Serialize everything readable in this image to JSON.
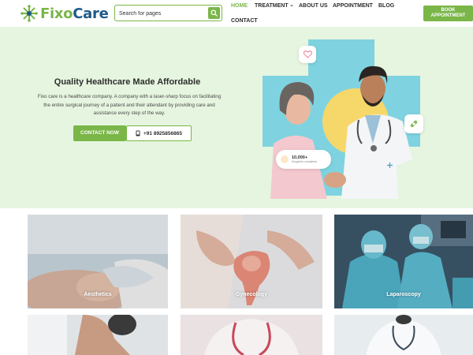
{
  "brand": {
    "name_part1": "Fixo",
    "name_part2": "Care"
  },
  "search": {
    "placeholder": "Search for pages"
  },
  "nav": {
    "items": [
      {
        "label": "HOME",
        "active": true
      },
      {
        "label": "TREATMENT",
        "has_dropdown": true
      },
      {
        "label": "ABOUT US"
      },
      {
        "label": "APPOINTMENT"
      },
      {
        "label": "BLOG"
      },
      {
        "label": "CONTACT"
      }
    ],
    "book_button": [
      "BOOK",
      "APPOINTMENT"
    ]
  },
  "hero": {
    "title": "Quality Healthcare Made Affordable",
    "description": "Fixo care is a healthcare company. A company with a laser-sharp focus on facilitating the entire surgical journey of a patient and their attendant by providing care and assistance every step of the way.",
    "contact_button": "CONTACT NOW",
    "phone": "+91 8925856865",
    "stat_number": "10,000+",
    "stat_label": "Surgeries completed"
  },
  "services": [
    {
      "label": "Aesthetics"
    },
    {
      "label": "Gynecology"
    },
    {
      "label": "Laparoscopy"
    },
    {
      "label": ""
    },
    {
      "label": ""
    },
    {
      "label": ""
    }
  ],
  "colors": {
    "brand_green": "#7ab648",
    "brand_blue": "#1d5a8a",
    "hero_bg": "#e6f5df",
    "accent_teal": "#7fd3e0",
    "accent_yellow": "#f6d76a"
  },
  "icons": {
    "search": "search-icon",
    "phone": "phone-icon",
    "heart": "heart-icon",
    "bandage": "bandage-icon",
    "logo": "snowflake-logo-icon"
  }
}
